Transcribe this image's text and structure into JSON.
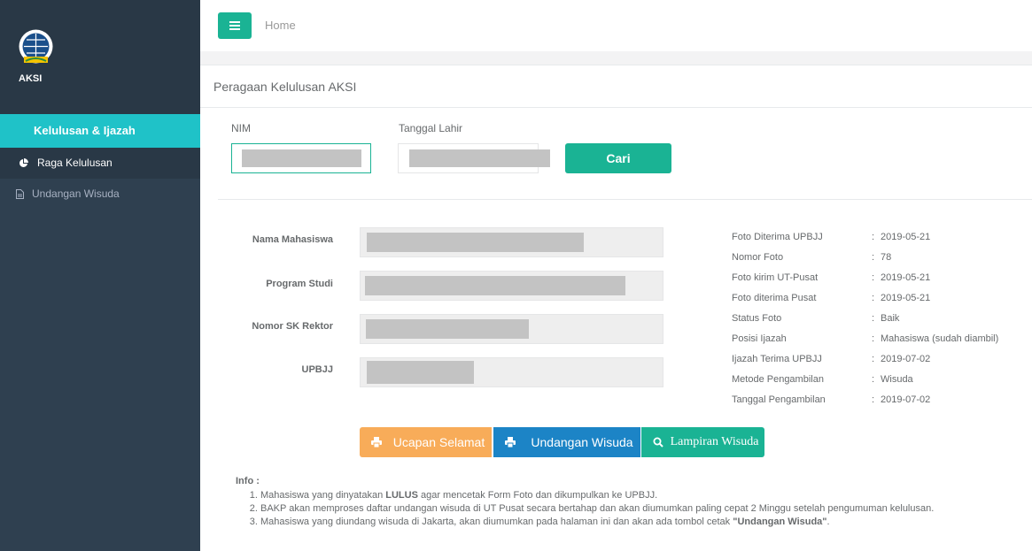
{
  "sidebar": {
    "brand": "AKSI",
    "active_menu": "Kelulusan & Ijazah",
    "items": [
      {
        "label": "Raga Kelulusan",
        "icon": "pie-chart-icon"
      },
      {
        "label": "Undangan Wisuda",
        "icon": "file-icon"
      }
    ]
  },
  "topbar": {
    "breadcrumb": "Home"
  },
  "page": {
    "title": "Peragaan Kelulusan",
    "subtitle": "AKSI"
  },
  "search": {
    "nim_label": "NIM",
    "dob_label": "Tanggal Lahir",
    "submit_label": "Cari"
  },
  "student": {
    "labels": [
      "Nama Mahasiswa",
      "Program Studi",
      "Nomor SK Rektor",
      "UPBJJ"
    ]
  },
  "details": [
    {
      "key": "Foto Diterima UPBJJ",
      "value": "2019-05-21"
    },
    {
      "key": "Nomor Foto",
      "value": "78"
    },
    {
      "key": "Foto kirim UT-Pusat",
      "value": "2019-05-21"
    },
    {
      "key": "Foto diterima Pusat",
      "value": "2019-05-21"
    },
    {
      "key": "Status Foto",
      "value": "Baik"
    },
    {
      "key": "Posisi Ijazah",
      "value": "Mahasiswa (sudah diambil)"
    },
    {
      "key": "Ijazah Terima UPBJJ",
      "value": "2019-07-02"
    },
    {
      "key": "Metode Pengambilan",
      "value": "Wisuda"
    },
    {
      "key": "Tanggal Pengambilan",
      "value": "2019-07-02"
    }
  ],
  "actions": {
    "ucapan": "Ucapan Selamat",
    "undangan": "Undangan Wisuda",
    "lampiran": "Lampiran Wisuda"
  },
  "info": {
    "heading": "Info :",
    "item1_pre": "Mahasiswa yang dinyatakan ",
    "item1_bold": "LULUS",
    "item1_post": " agar mencetak Form Foto dan dikumpulkan ke UPBJJ.",
    "item2": "BAKP akan memproses daftar undangan wisuda di UT Pusat secara bertahap dan akan diumumkan paling cepat 2 Minggu setelah pengumuman kelulusan.",
    "item3_pre": "Mahasiswa yang diundang wisuda di Jakarta, akan diumumkan pada halaman ini dan akan ada tombol cetak ",
    "item3_bold": "\"Undangan Wisuda\"",
    "item3_post": "."
  },
  "colors": {
    "sidebar": "#2f4050",
    "active": "#1fc2c8",
    "primary": "#1ab394",
    "warning": "#f8ac59",
    "success": "#1c84c6"
  }
}
